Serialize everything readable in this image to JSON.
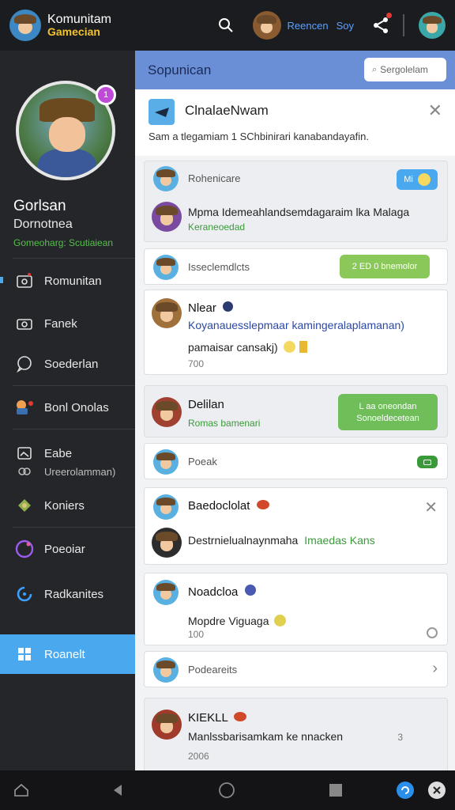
{
  "topbar": {
    "app_title_1": "Komunitam",
    "app_title_2": "Gamecian",
    "user_name": "Reencen",
    "user_tag": "Soy",
    "icons": [
      "search-icon",
      "share-icon"
    ]
  },
  "sidebar": {
    "profile_name": "Gorlsan",
    "profile_sub": "Dornotnea",
    "profile_status": "Gomeoharg: Scutiaiean",
    "badge": "1",
    "items": [
      {
        "label": "Romunitan",
        "icon": "community-icon"
      },
      {
        "label": "Fanek",
        "icon": "camera-icon"
      },
      {
        "label": "Soederlan",
        "icon": "chat-icon"
      },
      {
        "label": "Bonl Onolas",
        "icon": "game-icon"
      },
      {
        "label": "Eabe",
        "icon": "image-icon",
        "sub": "Ureerolamman)"
      },
      {
        "label": "Koniers",
        "icon": "leaf-icon"
      },
      {
        "label": "Poeoiar",
        "icon": "record-icon"
      },
      {
        "label": "Radkanites",
        "icon": "refresh-icon"
      },
      {
        "label": "Roanelt",
        "icon": "grid-icon",
        "active": true
      }
    ]
  },
  "main": {
    "header_title": "Sopunican",
    "search_placeholder": "Sergolelam",
    "info_card": {
      "title": "ClnalaeNwam",
      "desc": "Sam a tlegamiam 1 SChbinirari kanabandayafin."
    },
    "cards": [
      {
        "label": "Rohenicare",
        "pill": "Mi",
        "line": "Mpma Idemeahlandsemdagaraim lka Malaga",
        "green": "Keraneoedad"
      },
      {
        "label": "Isseclemdlcts",
        "pill": "2 ED 0 bnemolor"
      },
      {
        "title": "Nlear",
        "blue": "Koyanauesslepmaar kamingeralaplamanan)",
        "line": "pamaisar cansakj)",
        "meta": "700"
      },
      {
        "title": "Delilan",
        "green": "Romas bamenari",
        "pill_line1": "L aa oneondan",
        "pill_line2": "Sonoeldecetean"
      },
      {
        "label": "Poeak"
      },
      {
        "title": "Baedoclolat",
        "line": "Destrnielualnaynmaha",
        "green_inline": "Imaedas Kans"
      },
      {
        "title": "Noadcloa",
        "line": "Mopdre Viguaga",
        "meta": "100"
      },
      {
        "label": "Podeareits"
      },
      {
        "title": "KIEKLL",
        "line": "Manlssbarisamkam ke nnacken",
        "meta": "2006",
        "count": "3"
      }
    ]
  },
  "bottombar": {
    "icons": [
      "home-icon",
      "back-icon",
      "circle-home-icon",
      "square-recent-icon",
      "app-icon",
      "close-icon"
    ]
  },
  "colors": {
    "accent": "#4aa8ee",
    "header": "#6a8fd6",
    "green": "#8ac859"
  }
}
